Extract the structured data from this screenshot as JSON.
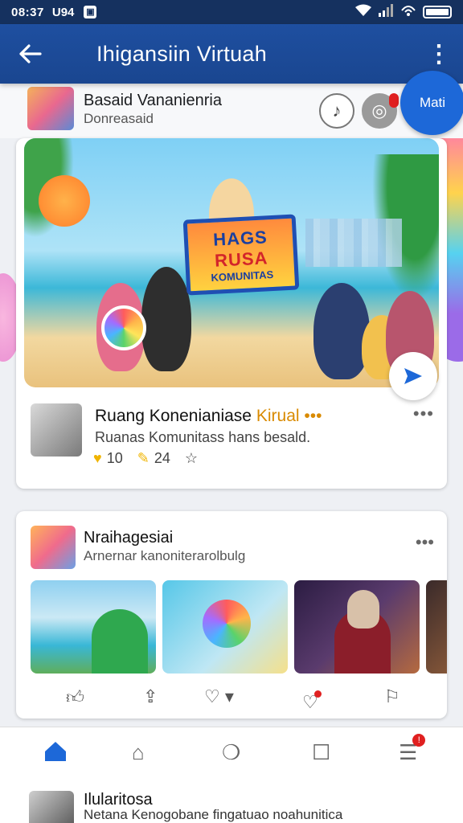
{
  "status_bar": {
    "time": "08:37",
    "carrier": "U94",
    "notif_icon": "app-icon"
  },
  "app_bar": {
    "title": "Ihigansiin Virtuah"
  },
  "group": {
    "name": "Basaid Vananienria",
    "subtitle": "Donreasaid"
  },
  "fab_label": "Mati",
  "hero": {
    "sign_line1": "HAGS",
    "sign_line2": "RUSA",
    "sign_line3": "KOMUNITAS"
  },
  "post": {
    "title_main": "Ruang Konenianiase",
    "title_highlight": "Kirual",
    "description": "Ruanas Komunitass hans besald.",
    "likes": "10",
    "comments": "24"
  },
  "card2": {
    "name": "Nraihagesiai",
    "subtitle": "Arnernar kanoniterarolbulg"
  },
  "peek": {
    "name": "Ilularitosa",
    "subtitle": "Netana Kenogobane fingatuao noahunitica"
  },
  "colors": {
    "primary": "#1a4690",
    "accent": "#1d68d8",
    "highlight": "#d98a00",
    "badge": "#e02020"
  }
}
